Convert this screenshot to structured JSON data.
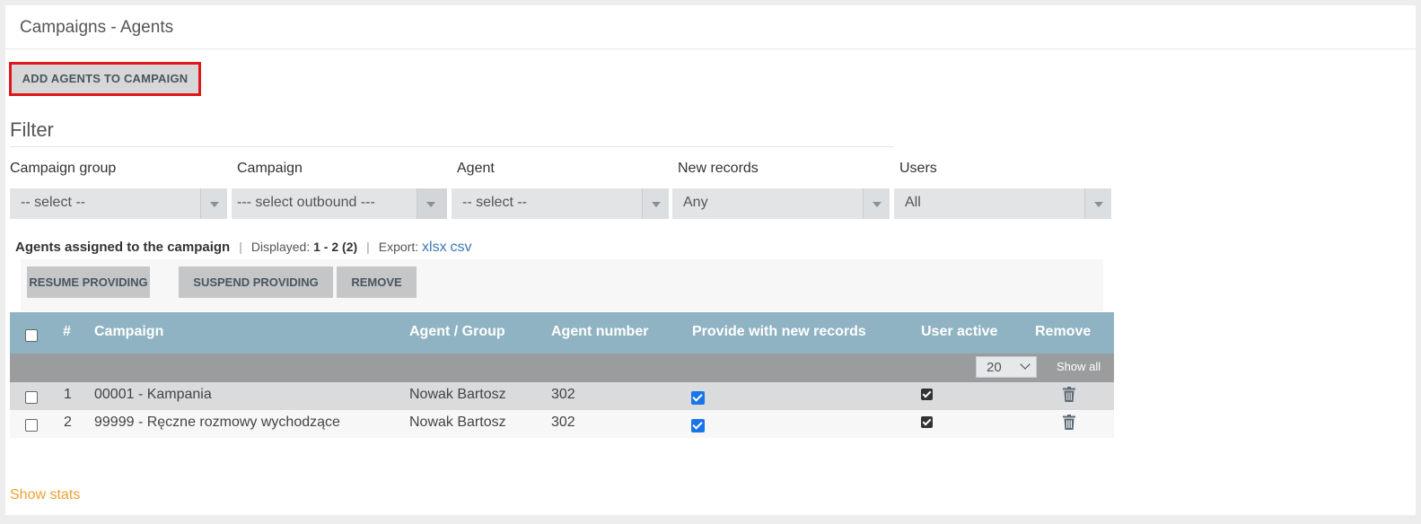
{
  "header": {
    "title": "Campaigns - Agents"
  },
  "toolbar": {
    "add_agents_label": "ADD AGENTS TO CAMPAIGN"
  },
  "filter": {
    "title": "Filter",
    "fields": [
      {
        "label": "Campaign group",
        "value": "-- select --"
      },
      {
        "label": "Campaign",
        "value": "--- select outbound ---"
      },
      {
        "label": "Agent",
        "value": "-- select --"
      },
      {
        "label": "New records",
        "value": "Any"
      },
      {
        "label": "Users",
        "value": "All"
      }
    ]
  },
  "summary": {
    "title": "Agents assigned to the campaign",
    "displayed_label": "Displayed:",
    "displayed_value": "1 - 2 (2)",
    "export_label": "Export:",
    "export_xlsx": "xlsx",
    "export_csv": "csv"
  },
  "actions": {
    "resume_label": "RESUME PROVIDING",
    "suspend_label": "SUSPEND PROVIDING",
    "remove_label": "REMOVE"
  },
  "table": {
    "headers": {
      "index": "#",
      "campaign": "Campaign",
      "agent_group": "Agent / Group",
      "agent_number": "Agent number",
      "provide": "Provide with new records",
      "user_active": "User active",
      "remove": "Remove"
    },
    "page_size": "20",
    "show_all": "Show all",
    "rows": [
      {
        "index": "1",
        "campaign": "00001 - Kampania",
        "agent": "Nowak Bartosz",
        "number": "302",
        "provide": true,
        "active": true
      },
      {
        "index": "2",
        "campaign": "99999 - Ręczne rozmowy wychodzące",
        "agent": "Nowak Bartosz",
        "number": "302",
        "provide": true,
        "active": true
      }
    ]
  },
  "footer": {
    "show_stats": "Show stats"
  },
  "colors": {
    "accent_red": "#e0161c",
    "table_header": "#8fb3c2",
    "link_blue": "#3a78b5",
    "stats_orange": "#f0a030"
  }
}
